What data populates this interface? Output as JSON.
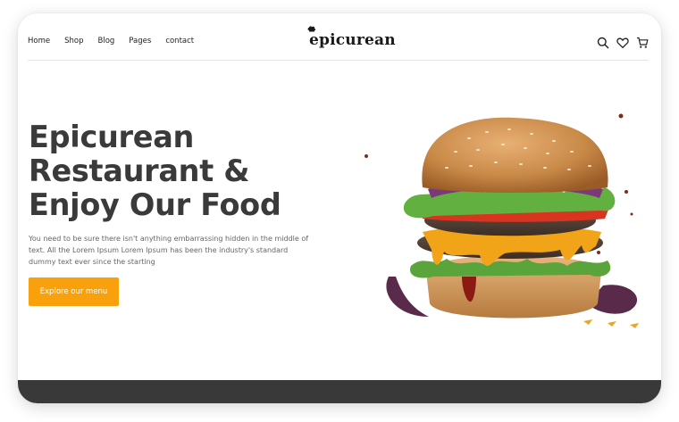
{
  "header": {
    "nav": [
      "Home",
      "Shop",
      "Blog",
      "Pages",
      "contact"
    ],
    "logo": "epicurean",
    "icons": [
      "search-icon",
      "heart-icon",
      "cart-icon"
    ]
  },
  "hero": {
    "title_lines": [
      "Epicurean",
      "Restaurant &",
      "Enjoy Our Food"
    ],
    "description": "You need to be sure there isn't anything embarrassing hidden in the middle of text. All the Lorem Ipsum Lorem Ipsum has been the industry's standard dummy text ever since the starting",
    "cta_label": "Explore our menu"
  },
  "colors": {
    "accent": "#f8a10d",
    "title": "#3a3a3a",
    "footer": "#393939"
  }
}
